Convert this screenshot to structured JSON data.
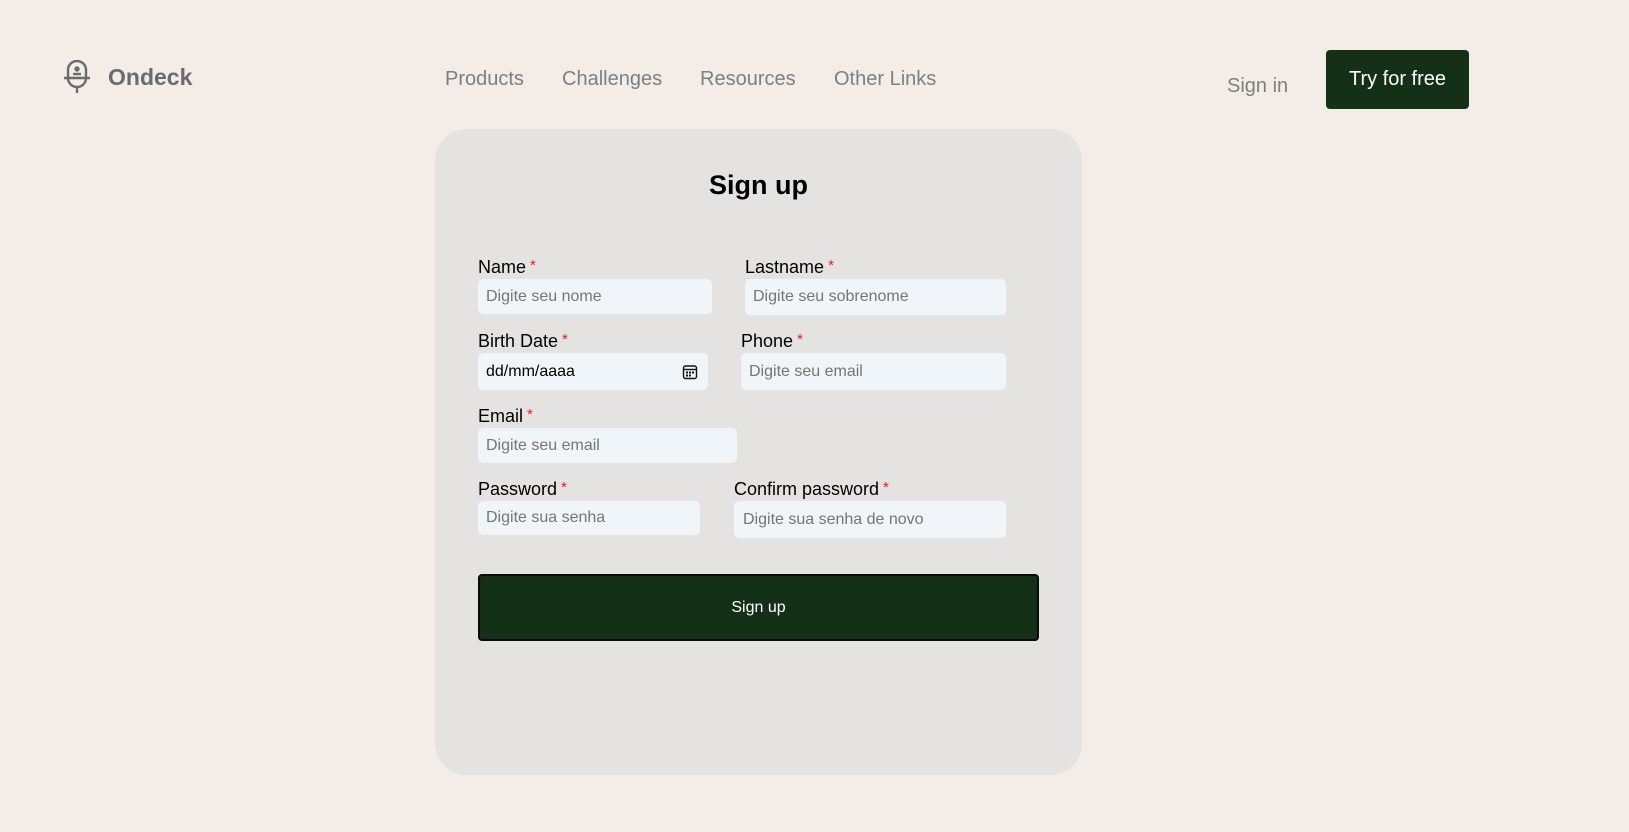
{
  "brand": {
    "name": "Ondeck",
    "icon": "logo-mic-icon"
  },
  "nav": {
    "items": [
      {
        "label": "Products"
      },
      {
        "label": "Challenges"
      },
      {
        "label": "Resources"
      },
      {
        "label": "Other Links"
      }
    ],
    "sign_in": "Sign in",
    "try_free": "Try for free"
  },
  "form": {
    "title": "Sign up",
    "required_mark": "*",
    "name": {
      "label": "Name",
      "placeholder": "Digite seu nome"
    },
    "lastname": {
      "label": "Lastname",
      "placeholder": "Digite seu sobrenome"
    },
    "birth_date": {
      "label": "Birth Date",
      "value": "dd/mm/aaaa"
    },
    "phone": {
      "label": "Phone",
      "placeholder": "Digite seu email"
    },
    "email": {
      "label": "Email",
      "placeholder": "Digite seu email"
    },
    "password": {
      "label": "Password",
      "placeholder": "Digite sua senha"
    },
    "confirm_password": {
      "label": "Confirm password",
      "placeholder": "Digite sua senha de novo"
    },
    "submit": "Sign up"
  },
  "colors": {
    "background": "#f4ece6",
    "card": "#e5e3e1",
    "primary": "#143118",
    "input": "#f0f5fa",
    "required": "#e52020"
  }
}
